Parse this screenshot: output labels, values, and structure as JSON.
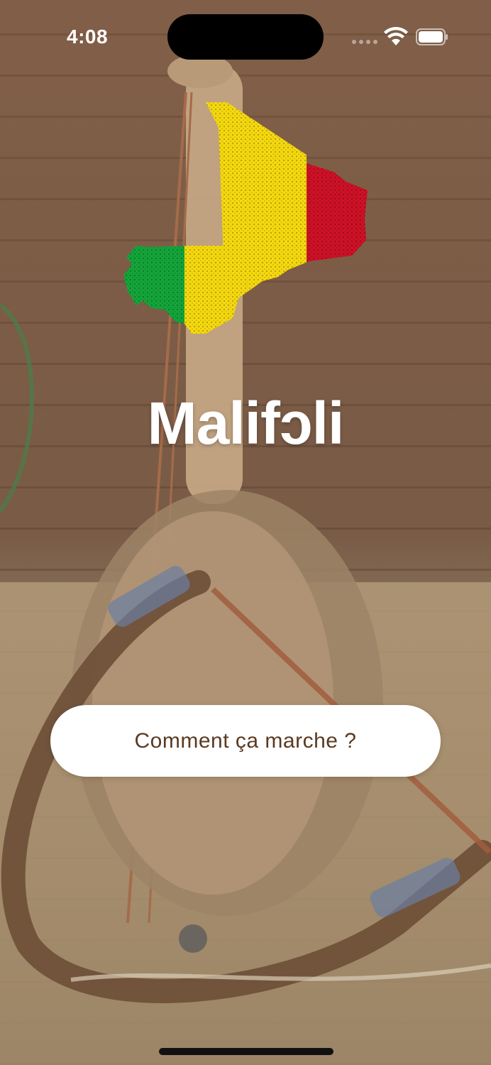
{
  "status_bar": {
    "time": "4:08"
  },
  "app": {
    "title": "Malifɔli"
  },
  "actions": {
    "how_it_works_label": "Comment ça marche ?"
  },
  "colors": {
    "flag_green": "#14a53a",
    "flag_yellow": "#f5d90f",
    "flag_red": "#ce1126",
    "button_text": "#5a3a22",
    "button_bg": "#ffffff"
  },
  "icons": {
    "wifi": "wifi-icon",
    "battery": "battery-icon",
    "signal": "cellular-signal-icon",
    "map": "mali-flag-map-icon"
  }
}
